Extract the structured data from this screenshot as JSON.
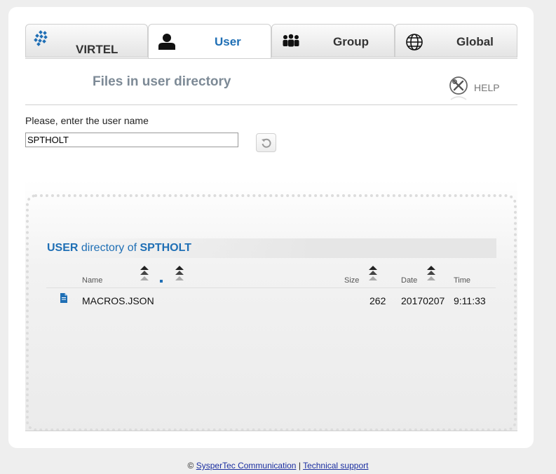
{
  "tabs": [
    {
      "label": "VIRTEL",
      "icon": "virtel-logo-icon"
    },
    {
      "label": "User",
      "icon": "user-icon"
    },
    {
      "label": "Group",
      "icon": "group-icon"
    },
    {
      "label": "Global",
      "icon": "globe-icon"
    }
  ],
  "header": {
    "title": "Files in user directory",
    "help_label": "HELP"
  },
  "form": {
    "prompt": "Please, enter the user name",
    "username": "SPTHOLT"
  },
  "directory": {
    "title_prefix": "USER",
    "title_middle": " directory of ",
    "title_user": "SPTHOLT",
    "columns": {
      "name": "Name",
      "size": "Size",
      "date": "Date",
      "time": "Time"
    },
    "files": [
      {
        "name": "MACROS.JSON",
        "size": "262",
        "date": "20170207",
        "time": "9:11:33"
      }
    ]
  },
  "footer": {
    "copyright": "©",
    "company_link": "SysperTec Communication",
    "separator": "|",
    "support_link": "Technical support"
  },
  "colors": {
    "accent": "#1f6fb5",
    "title_gray": "#7d8a96"
  }
}
